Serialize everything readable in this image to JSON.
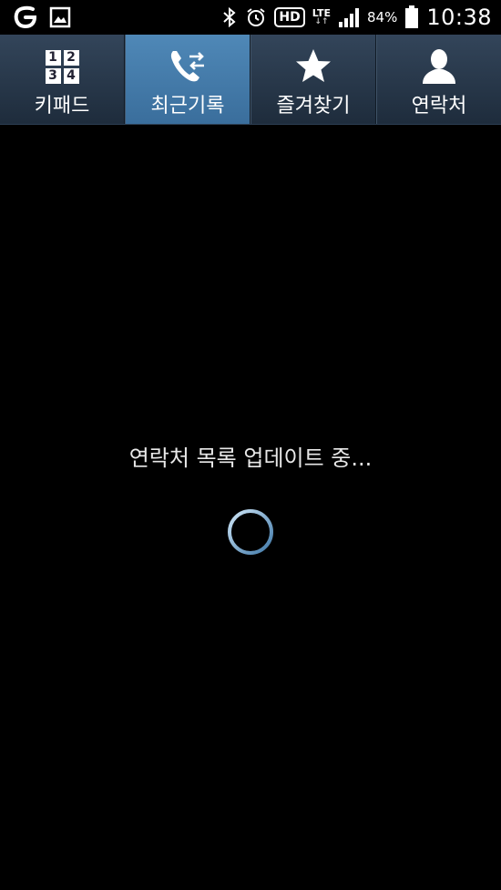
{
  "status_bar": {
    "hd_label": "HD",
    "lte_label": "LTE",
    "lte_arrows": "↓↑",
    "battery_percent": "84%",
    "time": "10:38"
  },
  "tabs": [
    {
      "label": "키패드",
      "icon": "keypad-icon",
      "active": false,
      "keys": [
        "1",
        "2",
        "3",
        "4"
      ]
    },
    {
      "label": "최근기록",
      "icon": "call-log-icon",
      "active": true
    },
    {
      "label": "즐겨찾기",
      "icon": "star-icon",
      "active": false
    },
    {
      "label": "연락처",
      "icon": "contact-icon",
      "active": false
    }
  ],
  "main": {
    "loading_text": "연락처 목록 업데이트 중..."
  },
  "colors": {
    "tab_bar": "#2a3a4d",
    "tab_active": "#4a82b0",
    "spinner": "#7ab0d8"
  }
}
